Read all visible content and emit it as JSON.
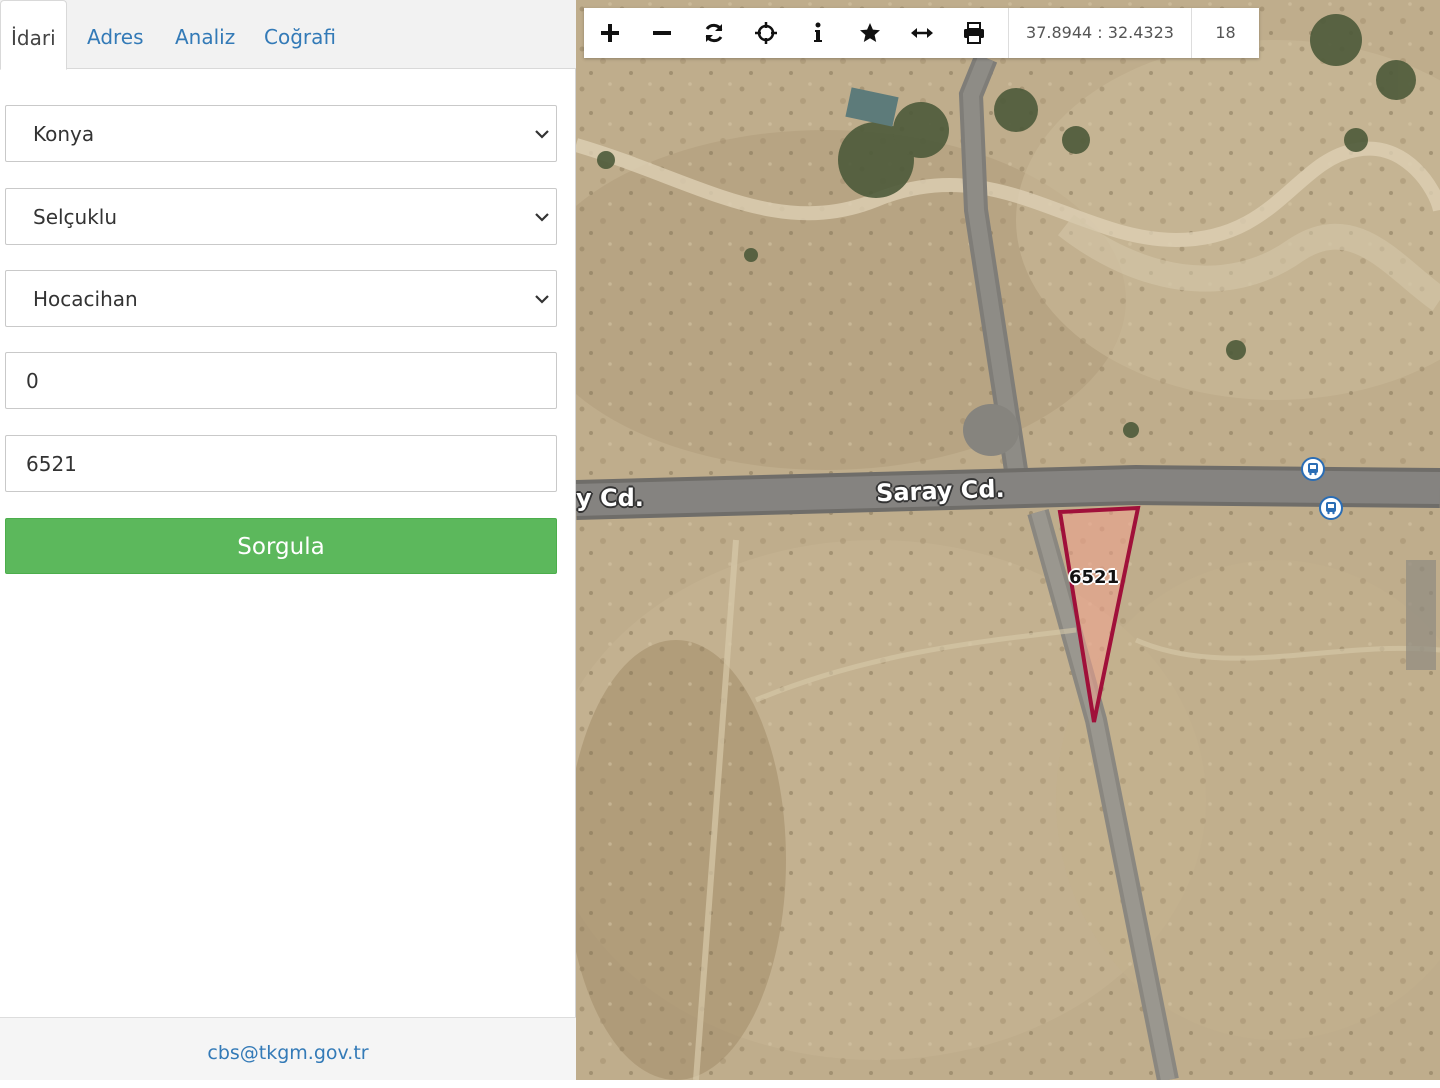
{
  "tabs": [
    {
      "label": "İdari",
      "active": true
    },
    {
      "label": "Adres",
      "active": false
    },
    {
      "label": "Analiz",
      "active": false
    },
    {
      "label": "Coğrafi",
      "active": false
    }
  ],
  "form": {
    "il": "Konya",
    "ilce": "Selçuklu",
    "mahalle": "Hocacihan",
    "ada": "0",
    "parsel": "6521",
    "submit_label": "Sorgula"
  },
  "footer": {
    "email": "cbs@tkgm.gov.tr"
  },
  "map": {
    "toolbar": {
      "icons": [
        "zoom-in-icon",
        "zoom-out-icon",
        "refresh-icon",
        "locate-icon",
        "info-icon",
        "favorite-icon",
        "measure-icon",
        "print-icon"
      ],
      "coordinates": "37.8944 : 32.4323",
      "zoom_level": "18"
    },
    "road_labels": {
      "main": "Saray Cd.",
      "partial": "y Cd."
    },
    "parcel": {
      "label": "6521",
      "stroke": "#a0103a",
      "fill": "#f3a38e"
    }
  },
  "colors": {
    "accent": "#337ab7",
    "button": "#5cb85c"
  }
}
